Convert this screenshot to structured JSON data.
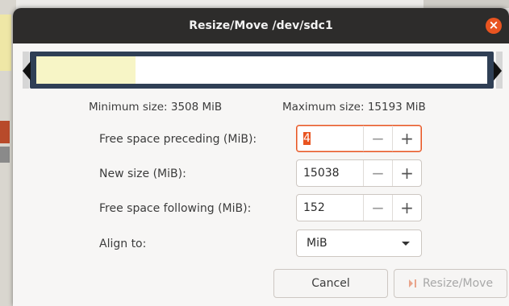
{
  "window": {
    "title": "Resize/Move /dev/sdc1"
  },
  "sizes": {
    "minimum_label": "Minimum size: 3508 MiB",
    "maximum_label": "Maximum size: 15193 MiB",
    "used_fraction": 0.22
  },
  "fields": {
    "preceding": {
      "label": "Free space preceding (MiB):",
      "value": "4"
    },
    "new_size": {
      "label": "New size (MiB):",
      "value": "15038"
    },
    "following": {
      "label": "Free space following (MiB):",
      "value": "152"
    },
    "align": {
      "label": "Align to:",
      "value": "MiB"
    }
  },
  "buttons": {
    "cancel": "Cancel",
    "resize_move": "Resize/Move"
  },
  "colors": {
    "accent": "#e95420",
    "titlebar": "#2d2c2b",
    "partition_frame": "#2f3f55",
    "used_fill": "#f7f5c6"
  },
  "icons": {
    "close": "close-icon",
    "minus": "minus-icon",
    "plus": "plus-icon",
    "dropdown": "chevron-down-icon",
    "resize": "resize-move-icon"
  }
}
